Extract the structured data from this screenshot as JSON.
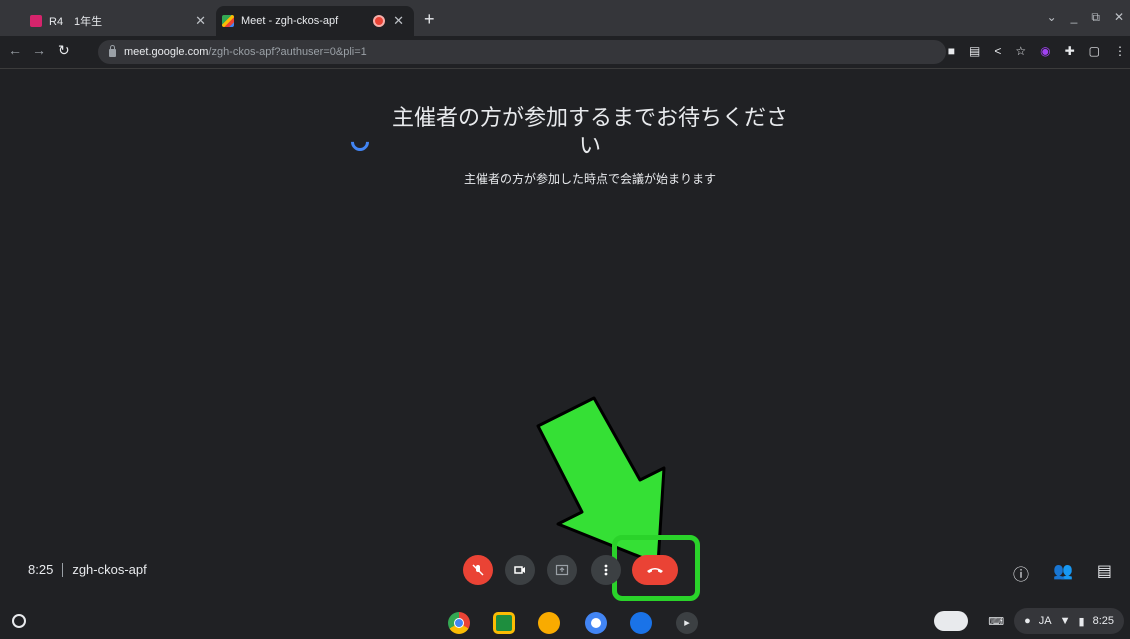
{
  "tabs": [
    {
      "label": "R4　1年生",
      "active": false,
      "favicon_color": "#d6246c"
    },
    {
      "label": "Meet - zgh-ckos-apf",
      "active": true,
      "recording": true
    }
  ],
  "new_tab_icon": "+",
  "window_controls": [
    "chevron-down-icon",
    "minimize-icon",
    "restore-icon",
    "close-icon"
  ],
  "address_bar": {
    "host": "meet.google.com",
    "path": "/zgh-ckos-apf?authuser=0&pli=1"
  },
  "main": {
    "waiting_title": "主催者の方が参加するまでお待ちください",
    "waiting_subtitle": "主催者の方が参加した時点で会議が始まります"
  },
  "meeting": {
    "time": "8:25",
    "code": "zgh-ckos-apf"
  },
  "controls": [
    {
      "name": "mic-off",
      "state": "off",
      "color": "#ea4335"
    },
    {
      "name": "camera"
    },
    {
      "name": "present-screen"
    },
    {
      "name": "more-options"
    },
    {
      "name": "leave-call",
      "color": "#ea4335"
    }
  ],
  "highlight_color": "#2ad32a",
  "tray": {
    "ime": "JA",
    "clock": "8:25"
  }
}
